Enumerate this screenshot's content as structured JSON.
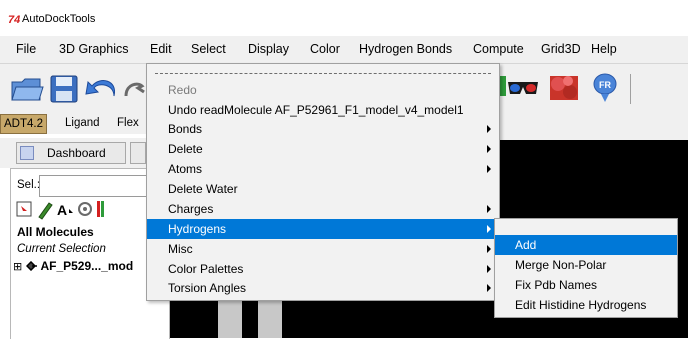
{
  "window": {
    "title": "AutoDockTools",
    "icon": "app-logo-icon"
  },
  "menubar": {
    "items": [
      "File",
      "3D Graphics",
      "Edit",
      "Select",
      "Display",
      "Color",
      "Hydrogen Bonds",
      "Compute",
      "Grid3D",
      "Help"
    ]
  },
  "toolbar": {
    "icons": [
      "open-folder-icon",
      "save-icon",
      "undo-icon",
      "redo-icon",
      "stereo-glasses-icon",
      "molecule-color-icon",
      "info-icon"
    ]
  },
  "adt_tabs": {
    "items": [
      "ADT4.2",
      "Ligand",
      "Flex"
    ]
  },
  "dashboard": {
    "label": "Dashboard"
  },
  "left_panel": {
    "sel_label": "Sel.:",
    "sel_value": "",
    "all_molecules": "All Molecules",
    "current_selection": "Current Selection",
    "molecule": "AF_P529..._mod",
    "icons": [
      "select-icon",
      "pencil-icon",
      "label-icon",
      "gear-search-icon",
      "color-bars-icon"
    ]
  },
  "edit_menu": {
    "items": [
      {
        "label": "Redo",
        "disabled": true,
        "submenu": false
      },
      {
        "label": "Undo readMolecule AF_P52961_F1_model_v4_model1",
        "disabled": false,
        "submenu": false
      },
      {
        "label": "Bonds",
        "disabled": false,
        "submenu": true
      },
      {
        "label": "Delete",
        "disabled": false,
        "submenu": true
      },
      {
        "label": "Atoms",
        "disabled": false,
        "submenu": true
      },
      {
        "label": "Delete Water",
        "disabled": false,
        "submenu": false
      },
      {
        "label": "Charges",
        "disabled": false,
        "submenu": true
      },
      {
        "label": "Hydrogens",
        "disabled": false,
        "submenu": true,
        "active": true
      },
      {
        "label": "Misc",
        "disabled": false,
        "submenu": true
      },
      {
        "label": "Color Palettes",
        "disabled": false,
        "submenu": true
      },
      {
        "label": "Torsion Angles",
        "disabled": false,
        "submenu": true
      }
    ]
  },
  "hydrogens_submenu": {
    "items": [
      {
        "label": "Add",
        "active": true
      },
      {
        "label": "Merge Non-Polar"
      },
      {
        "label": "Fix Pdb Names"
      },
      {
        "label": "Edit Histidine Hydrogens"
      }
    ]
  },
  "colors": {
    "highlight": "#0078d7",
    "menubar_bg": "#f0f0f0",
    "viewer_bg": "#000000",
    "tab_active": "#c7a86a"
  }
}
